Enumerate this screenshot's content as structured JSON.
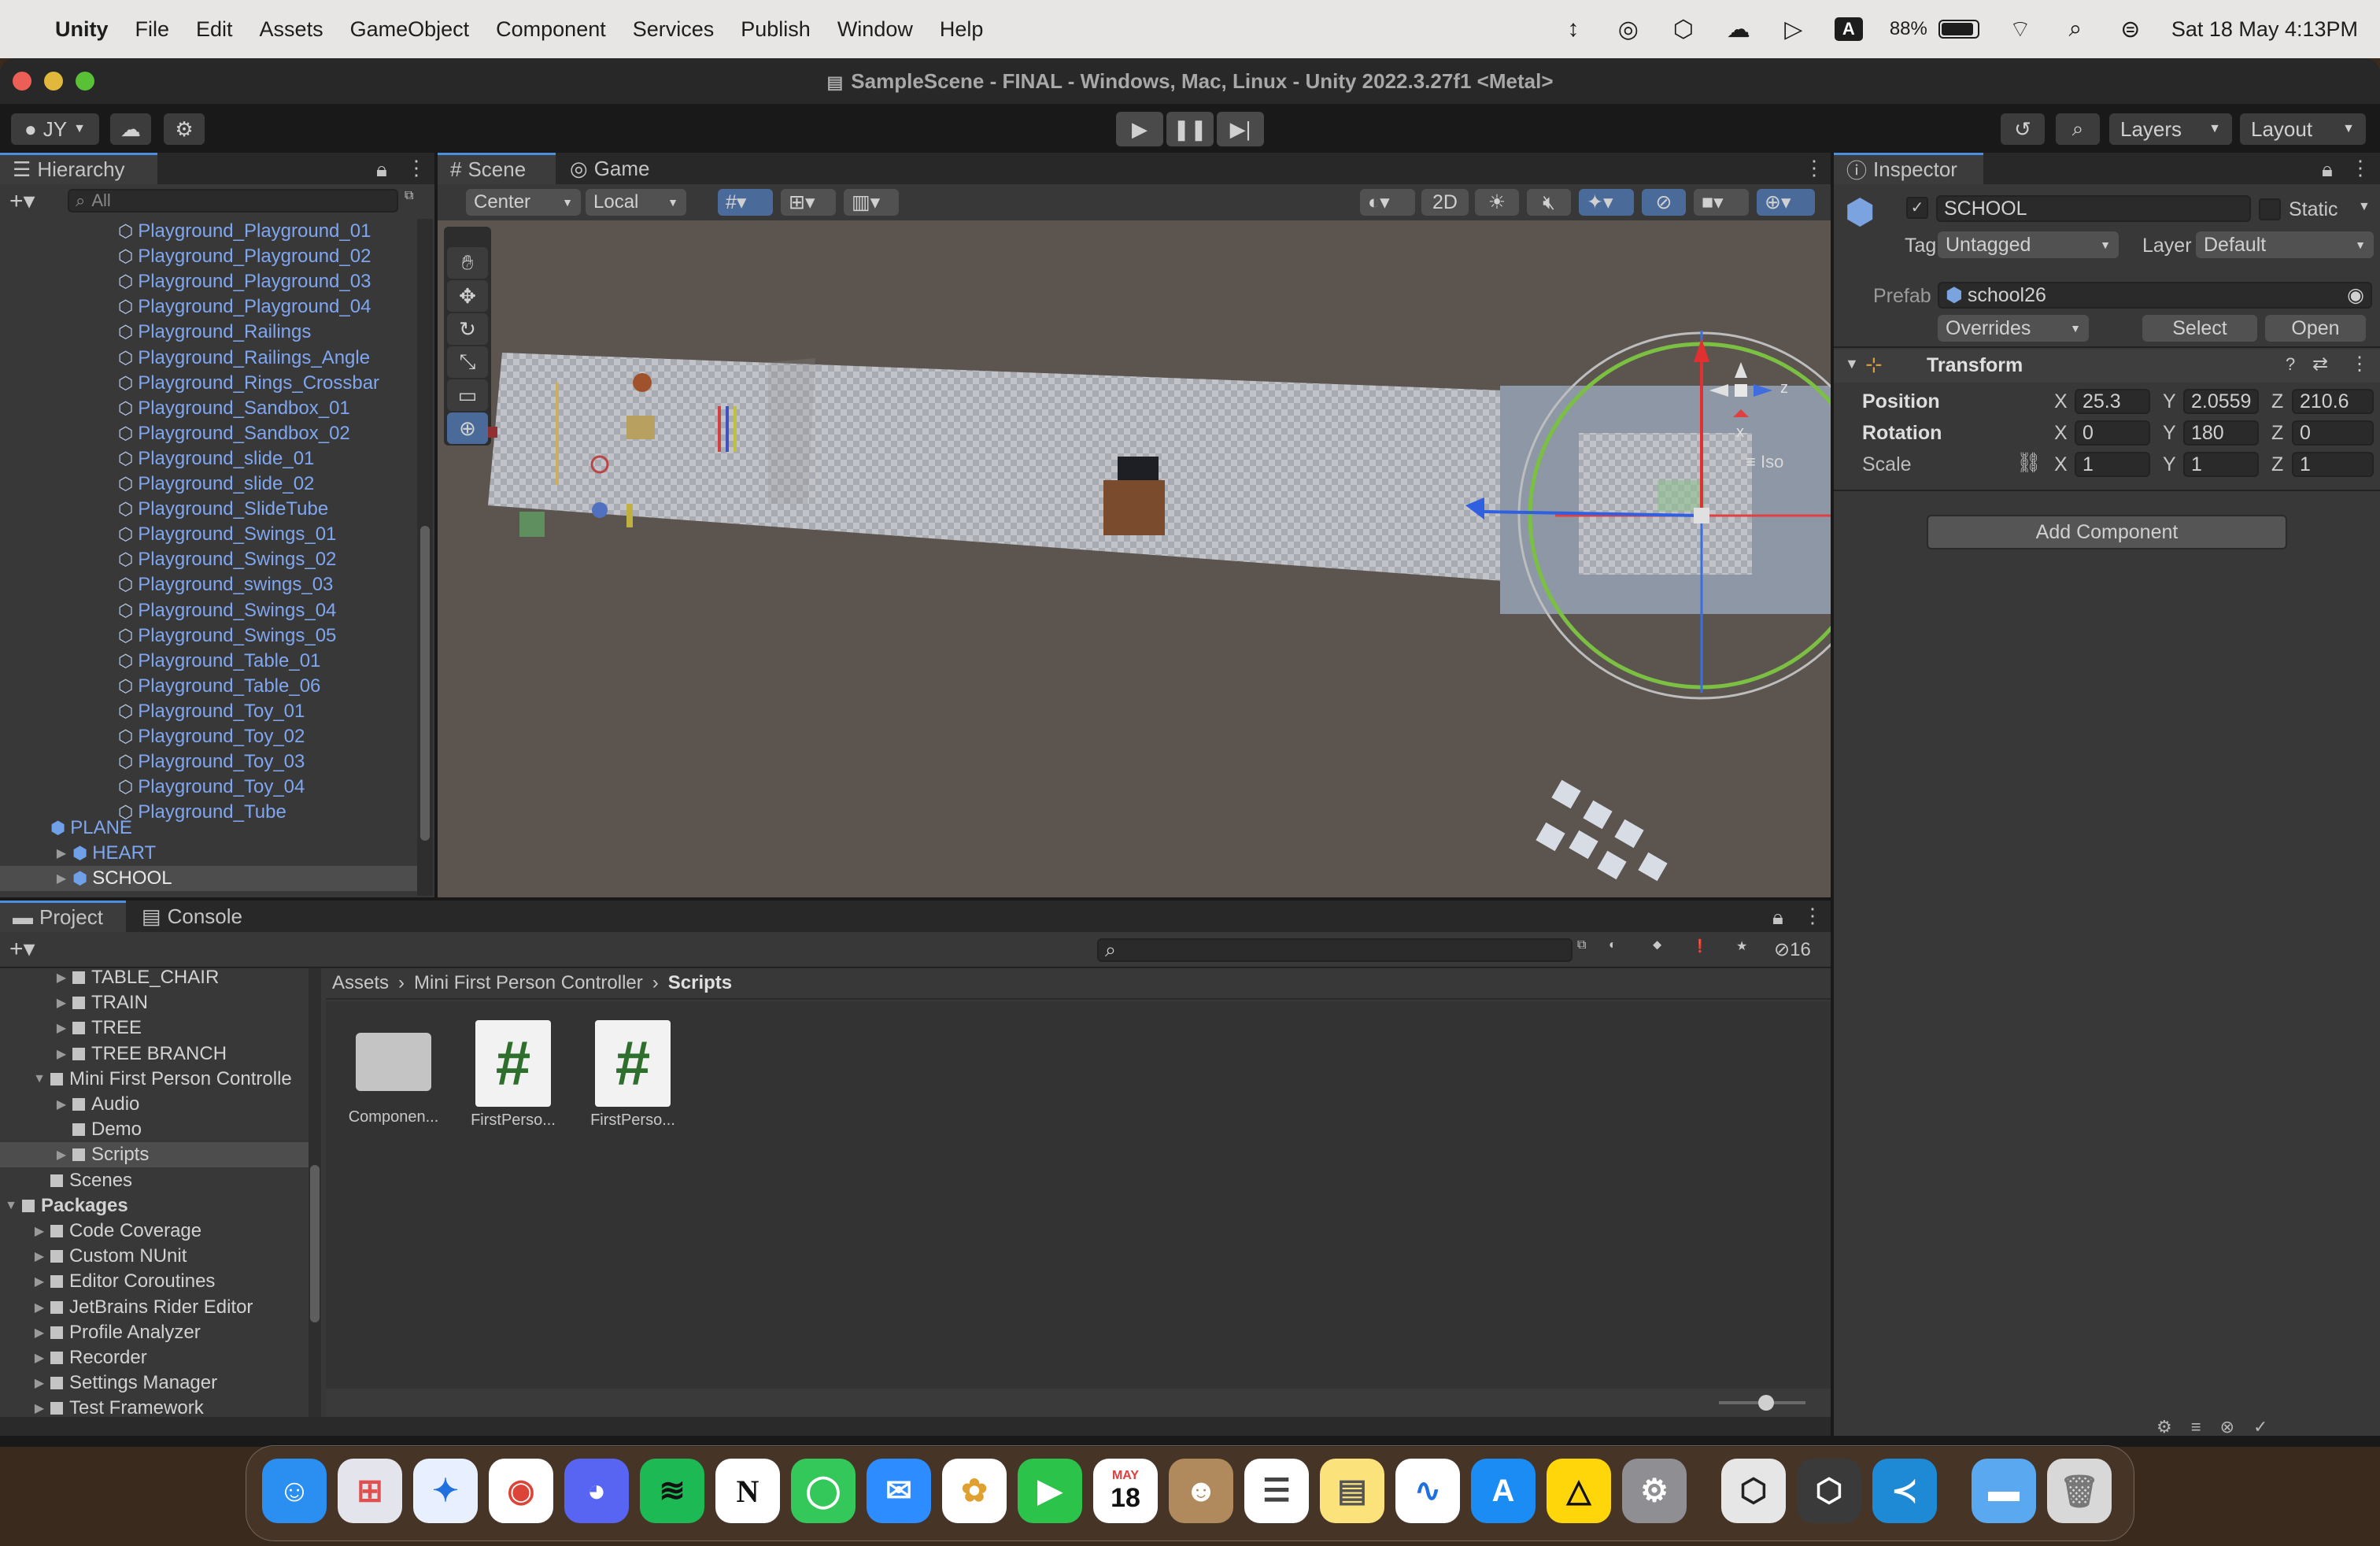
{
  "menubar": {
    "app": "Unity",
    "items": [
      "File",
      "Edit",
      "Assets",
      "GameObject",
      "Component",
      "Services",
      "Publish",
      "Window",
      "Help"
    ],
    "battery": "88%",
    "datetime": "Sat 18 May  4:13PM"
  },
  "window": {
    "title": "SampleScene - FINAL - Windows, Mac, Linux - Unity 2022.3.27f1 <Metal>"
  },
  "toolbar": {
    "account": "JY",
    "layers": "Layers",
    "layout": "Layout"
  },
  "hierarchy": {
    "tab": "Hierarchy",
    "search_placeholder": "All",
    "items": [
      "Playground_Playground_01",
      "Playground_Playground_02",
      "Playground_Playground_03",
      "Playground_Playground_04",
      "Playground_Railings",
      "Playground_Railings_Angle",
      "Playground_Rings_Crossbar",
      "Playground_Sandbox_01",
      "Playground_Sandbox_02",
      "Playground_slide_01",
      "Playground_slide_02",
      "Playground_SlideTube",
      "Playground_Swings_01",
      "Playground_Swings_02",
      "Playground_swings_03",
      "Playground_Swings_04",
      "Playground_Swings_05",
      "Playground_Table_01",
      "Playground_Table_06",
      "Playground_Toy_01",
      "Playground_Toy_02",
      "Playground_Toy_03",
      "Playground_Toy_04",
      "Playground_Tube"
    ],
    "roots": [
      "PLANE",
      "HEART",
      "SCHOOL"
    ]
  },
  "scene": {
    "tabs": [
      "Scene",
      "Game"
    ],
    "pivot": "Center",
    "space": "Local",
    "mode2d": "2D",
    "iso": "Iso",
    "axis_z": "z",
    "axis_x": "x"
  },
  "inspector": {
    "tab": "Inspector",
    "object": "SCHOOL",
    "static": "Static",
    "tag_label": "Tag",
    "tag": "Untagged",
    "layer_label": "Layer",
    "layer": "Default",
    "prefab_label": "Prefab",
    "prefab": "school26",
    "overrides": "Overrides",
    "select": "Select",
    "open": "Open",
    "transform": "Transform",
    "position": {
      "label": "Position",
      "x": "25.3",
      "y": "2.0559",
      "z": "210.6"
    },
    "rotation": {
      "label": "Rotation",
      "x": "0",
      "y": "180",
      "z": "0"
    },
    "scale": {
      "label": "Scale",
      "x": "1",
      "y": "1",
      "z": "1"
    },
    "add_component": "Add Component"
  },
  "project": {
    "tabs": [
      "Project",
      "Console"
    ],
    "hidden_count": "16",
    "breadcrumb": [
      "Assets",
      "Mini First Person Controller",
      "Scripts"
    ],
    "tree": [
      {
        "label": "TABLE_CHAIR",
        "indent": 1
      },
      {
        "label": "TRAIN",
        "indent": 1
      },
      {
        "label": "TREE",
        "indent": 1
      },
      {
        "label": "TREE BRANCH",
        "indent": 1
      },
      {
        "label": "Mini First Person Controlle",
        "indent": 0
      },
      {
        "label": "Audio",
        "indent": 1
      },
      {
        "label": "Demo",
        "indent": 1
      },
      {
        "label": "Scripts",
        "indent": 1
      },
      {
        "label": "Scenes",
        "indent": 0
      },
      {
        "label": "Packages",
        "indent": -1
      },
      {
        "label": "Code Coverage",
        "indent": 0
      },
      {
        "label": "Custom NUnit",
        "indent": 0
      },
      {
        "label": "Editor Coroutines",
        "indent": 0
      },
      {
        "label": "JetBrains Rider Editor",
        "indent": 0
      },
      {
        "label": "Profile Analyzer",
        "indent": 0
      },
      {
        "label": "Recorder",
        "indent": 0
      },
      {
        "label": "Settings Manager",
        "indent": 0
      },
      {
        "label": "Test Framework",
        "indent": 0
      }
    ],
    "assets": [
      {
        "name": "Componen...",
        "kind": "folder"
      },
      {
        "name": "FirstPerso...",
        "kind": "script"
      },
      {
        "name": "FirstPerso...",
        "kind": "script"
      }
    ]
  },
  "dock": {
    "calendar_month": "MAY",
    "calendar_day": "18"
  }
}
